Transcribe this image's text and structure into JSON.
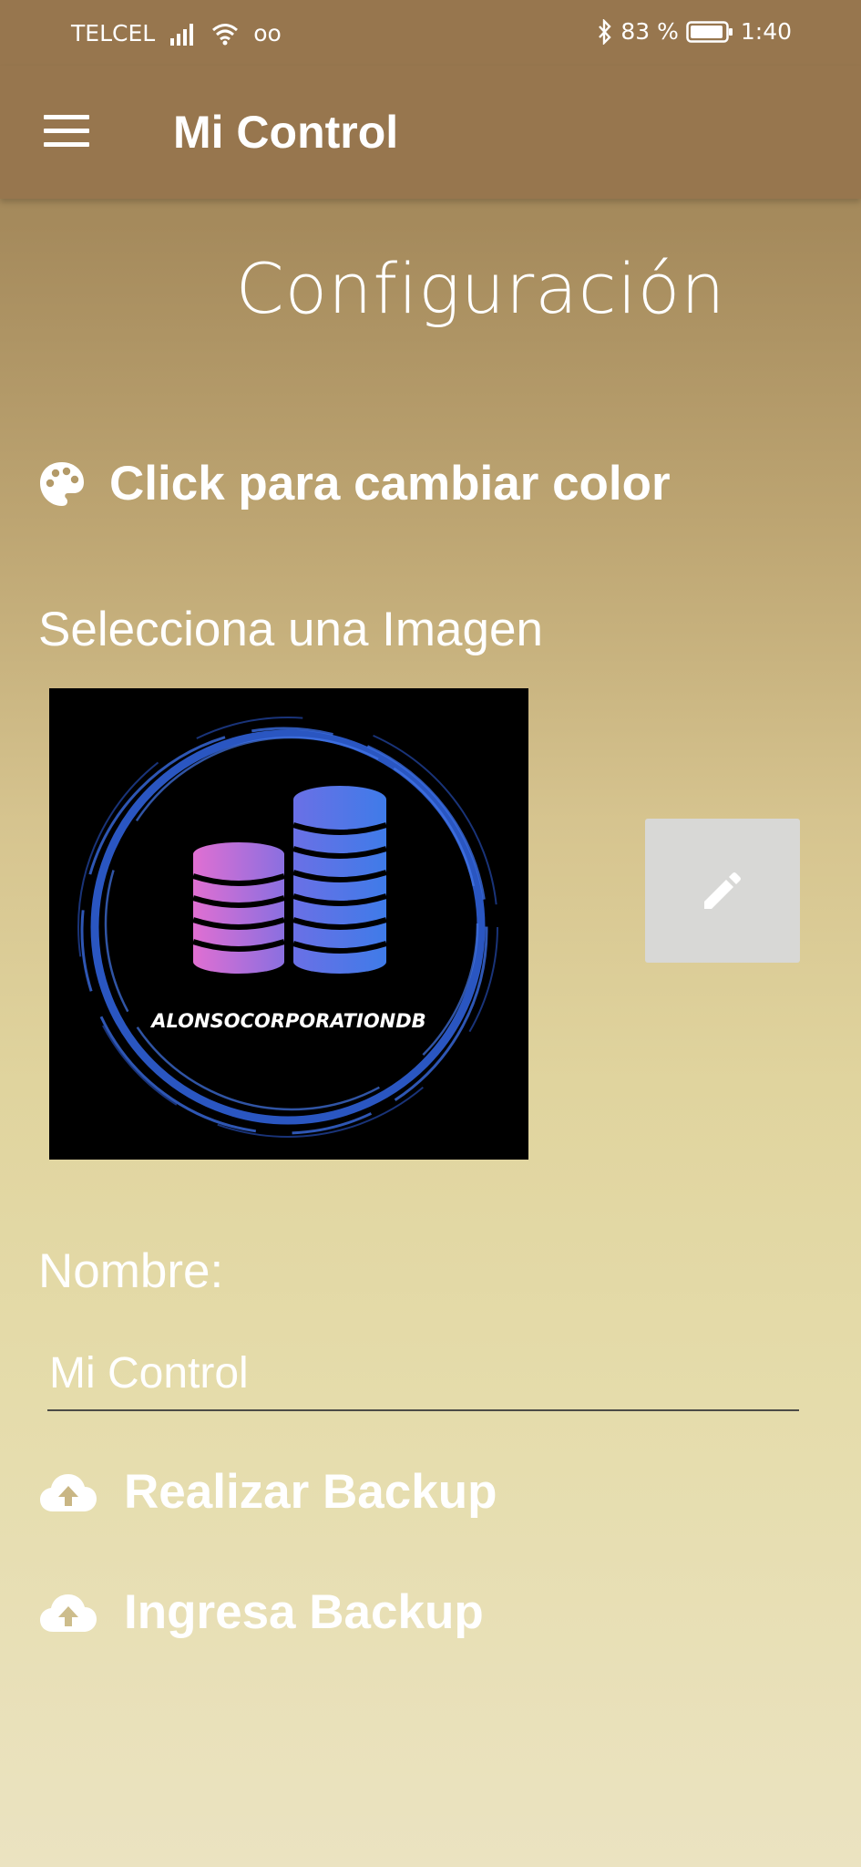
{
  "status_bar": {
    "carrier": "TELCEL",
    "voicemail": "oo",
    "battery": "83 %",
    "time": "1:40"
  },
  "app_bar": {
    "title": "Mi Control"
  },
  "page": {
    "title": "Configuración",
    "color_option": "Click para cambiar color",
    "image_heading": "Selecciona una Imagen",
    "logo_text": "ALONSOCORPORATIONDB",
    "name_label": "Nombre:",
    "name_value": "Mi Control",
    "backup_create": "Realizar Backup",
    "backup_import": "Ingresa Backup"
  },
  "colors": {
    "app_bar": "#97764e",
    "edit_button": "#d8d8d6",
    "logo_pink": "#e06fd2",
    "logo_blue": "#3f7be8"
  },
  "icons": [
    "menu-icon",
    "palette-icon",
    "edit-pencil-icon",
    "cloud-upload-icon",
    "signal-icon",
    "wifi-icon",
    "bluetooth-icon",
    "battery-icon"
  ]
}
